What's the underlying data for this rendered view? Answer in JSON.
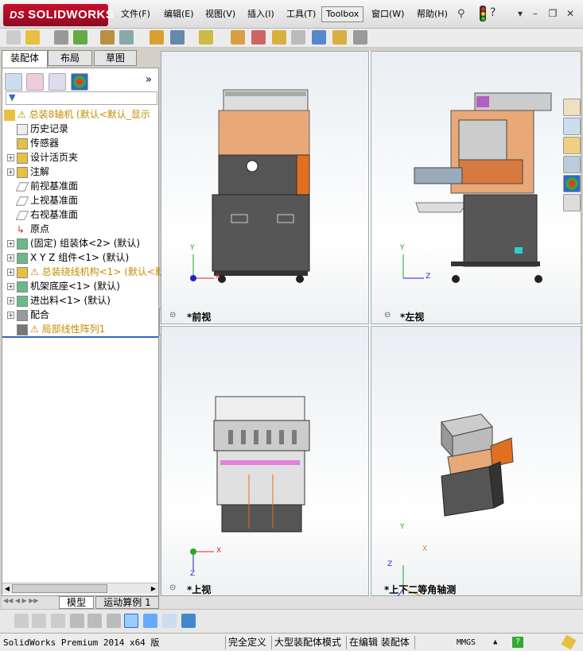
{
  "app": {
    "logo_text": "SOLIDWORKS",
    "logo_prefix": "DS"
  },
  "menu": [
    "文件(F)",
    "编辑(E)",
    "视图(V)",
    "插入(I)",
    "工具(T)",
    "Toolbox",
    "窗口(W)",
    "帮助(H)"
  ],
  "left_tabs": [
    "装配体",
    "布局",
    "草图"
  ],
  "tree": {
    "root": "总装8轴机  (默认<默认_显示",
    "items": [
      {
        "label": "历史记录",
        "icon": "history-icon",
        "expand": false
      },
      {
        "label": "传感器",
        "icon": "sensor-icon",
        "expand": false
      },
      {
        "label": "设计活页夹",
        "icon": "design-binder-icon",
        "expand": true
      },
      {
        "label": "注解",
        "icon": "annotation-icon",
        "expand": true
      },
      {
        "label": "前视基准面",
        "icon": "plane-icon",
        "expand": false
      },
      {
        "label": "上视基准面",
        "icon": "plane-icon",
        "expand": false
      },
      {
        "label": "右视基准面",
        "icon": "plane-icon",
        "expand": false
      },
      {
        "label": "原点",
        "icon": "origin-icon",
        "expand": false
      },
      {
        "label": "(固定) 组装体<2> (默认)",
        "icon": "assembly-icon",
        "expand": true
      },
      {
        "label": "X Y Z 组件<1> (默认)",
        "icon": "assembly-icon",
        "expand": true
      },
      {
        "label": "总装绕线机构<1> (默认<默认",
        "icon": "assembly-warning-icon",
        "expand": true,
        "warn": true
      },
      {
        "label": "机架底座<1> (默认)",
        "icon": "assembly-icon",
        "expand": true
      },
      {
        "label": "进出料<1> (默认)",
        "icon": "assembly-icon",
        "expand": true
      },
      {
        "label": "配合",
        "icon": "mates-icon",
        "expand": true
      },
      {
        "label": "局部线性阵列1",
        "icon": "pattern-icon",
        "expand": false,
        "warn": true
      }
    ]
  },
  "viewports": [
    {
      "label": "*前视"
    },
    {
      "label": "*左视"
    },
    {
      "label": "*上视"
    },
    {
      "label": "*上下二等角轴测"
    }
  ],
  "triad": {
    "x": "X",
    "y": "Y",
    "z": "Z"
  },
  "bottom_tabs": [
    "模型",
    "运动算例 1"
  ],
  "status": {
    "product": "SolidWorks Premium 2014 x64 版",
    "fully_defined": "完全定义",
    "large_assembly": "大型装配体模式",
    "editing": "在编辑 装配体",
    "units": "MMGS",
    "help": "?"
  },
  "colors": {
    "accent": "#c8102e",
    "warning": "#e8b000",
    "orange_panel": "#e8a878",
    "machine_gray": "#5a5a5a"
  }
}
